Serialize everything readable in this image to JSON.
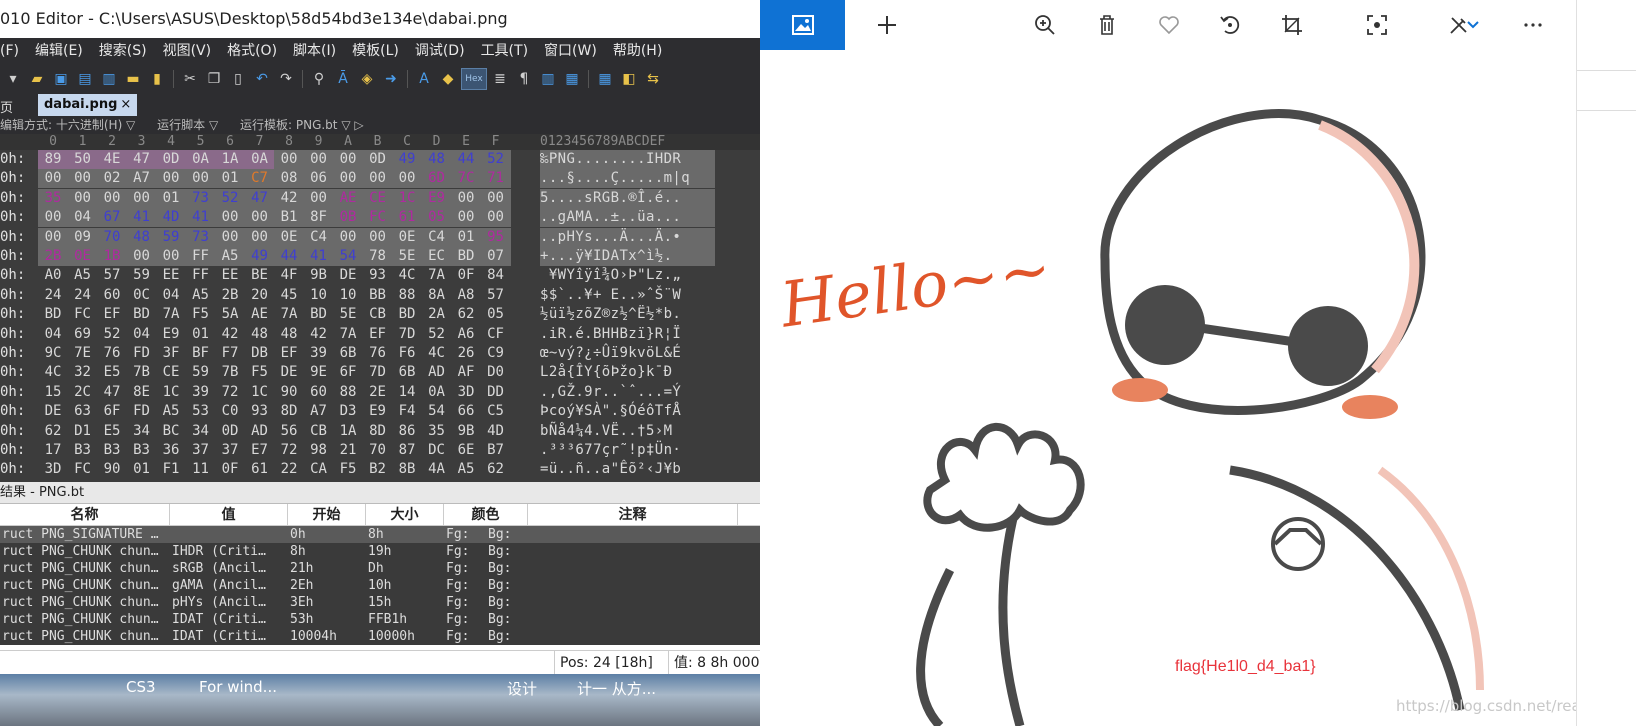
{
  "editor": {
    "title": "010 Editor - C:\\Users\\ASUS\\Desktop\\58d54bd3e134e\\dabai.png",
    "menu": [
      "(F)",
      "编辑(E)",
      "搜索(S)",
      "视图(V)",
      "格式(O)",
      "脚本(I)",
      "模板(L)",
      "调试(D)",
      "工具(T)",
      "窗口(W)",
      "帮助(H)"
    ],
    "tab_home": "页",
    "tab_file": "dabai.png",
    "tab_close": "×",
    "options": {
      "edit_mode": "编辑方式: 十六进制(H) ▽",
      "run_script": "运行脚本 ▽",
      "run_template": "运行模板: PNG.bt ▽ ▷"
    },
    "hex_header_cols": [
      "0",
      "1",
      "2",
      "3",
      "4",
      "5",
      "6",
      "7",
      "8",
      "9",
      "A",
      "B",
      "C",
      "D",
      "E",
      "F"
    ],
    "ascii_header": "0123456789ABCDEF",
    "rows": [
      {
        "off": "0h:",
        "bytes": [
          "89",
          "50",
          "4E",
          "47",
          "0D",
          "0A",
          "1A",
          "0A",
          "00",
          "00",
          "00",
          "0D",
          "49",
          "48",
          "44",
          "52"
        ],
        "ascii": "‰PNG........IHDR"
      },
      {
        "off": "0h:",
        "bytes": [
          "00",
          "00",
          "02",
          "A7",
          "00",
          "00",
          "01",
          "C7",
          "08",
          "06",
          "00",
          "00",
          "00",
          "6D",
          "7C",
          "71"
        ],
        "ascii": "...§....Ç.....m|q"
      },
      {
        "off": "0h:",
        "bytes": [
          "35",
          "00",
          "00",
          "00",
          "01",
          "73",
          "52",
          "47",
          "42",
          "00",
          "AE",
          "CE",
          "1C",
          "E9",
          "00",
          "00"
        ],
        "ascii": "5....sRGB.®Î.é.."
      },
      {
        "off": "0h:",
        "bytes": [
          "00",
          "04",
          "67",
          "41",
          "4D",
          "41",
          "00",
          "00",
          "B1",
          "8F",
          "0B",
          "FC",
          "61",
          "05",
          "00",
          "00"
        ],
        "ascii": "..gAMA..±..üa..."
      },
      {
        "off": "0h:",
        "bytes": [
          "00",
          "09",
          "70",
          "48",
          "59",
          "73",
          "00",
          "00",
          "0E",
          "C4",
          "00",
          "00",
          "0E",
          "C4",
          "01",
          "95"
        ],
        "ascii": "..pHYs...Ä...Ä.•"
      },
      {
        "off": "0h:",
        "bytes": [
          "2B",
          "0E",
          "1B",
          "00",
          "00",
          "FF",
          "A5",
          "49",
          "44",
          "41",
          "54",
          "78",
          "5E",
          "EC",
          "BD",
          "07"
        ],
        "ascii": "+...ÿ¥IDATx^ì½."
      },
      {
        "off": "0h:",
        "bytes": [
          "A0",
          "A5",
          "57",
          "59",
          "EE",
          "FF",
          "EE",
          "BE",
          "4F",
          "9B",
          "DE",
          "93",
          "4C",
          "7A",
          "0F",
          "84"
        ],
        "ascii": " ¥WYîÿî¾O›Þ\"Lz.„"
      },
      {
        "off": "0h:",
        "bytes": [
          "24",
          "24",
          "60",
          "0C",
          "04",
          "A5",
          "2B",
          "20",
          "45",
          "10",
          "10",
          "BB",
          "88",
          "8A",
          "A8",
          "57"
        ],
        "ascii": "$$`..¥+ E..»ˆŠ¨W"
      },
      {
        "off": "0h:",
        "bytes": [
          "BD",
          "FC",
          "EF",
          "BD",
          "7A",
          "F5",
          "5A",
          "AE",
          "7A",
          "BD",
          "5E",
          "CB",
          "BD",
          "2A",
          "62",
          "05"
        ],
        "ascii": "½üï½zõZ®z½^Ë½*b."
      },
      {
        "off": "0h:",
        "bytes": [
          "04",
          "69",
          "52",
          "04",
          "E9",
          "01",
          "42",
          "48",
          "48",
          "42",
          "7A",
          "EF",
          "7D",
          "52",
          "A6",
          "CF"
        ],
        "ascii": ".iR.é.BHHBzï}R¦Ï"
      },
      {
        "off": "0h:",
        "bytes": [
          "9C",
          "7E",
          "76",
          "FD",
          "3F",
          "BF",
          "F7",
          "DB",
          "EF",
          "39",
          "6B",
          "76",
          "F6",
          "4C",
          "26",
          "C9"
        ],
        "ascii": "œ~vý?¿÷Ûï9kvöL&É"
      },
      {
        "off": "0h:",
        "bytes": [
          "4C",
          "32",
          "E5",
          "7B",
          "CE",
          "59",
          "7B",
          "F5",
          "DE",
          "9E",
          "6F",
          "7D",
          "6B",
          "AD",
          "AF",
          "D0"
        ],
        "ascii": "L2å{ÎY{õÞžo}k­¯Ð"
      },
      {
        "off": "0h:",
        "bytes": [
          "15",
          "2C",
          "47",
          "8E",
          "1C",
          "39",
          "72",
          "1C",
          "90",
          "60",
          "88",
          "2E",
          "14",
          "0A",
          "3D",
          "DD"
        ],
        "ascii": ".,GŽ.9r..`ˆ...=Ý"
      },
      {
        "off": "0h:",
        "bytes": [
          "DE",
          "63",
          "6F",
          "FD",
          "A5",
          "53",
          "C0",
          "93",
          "8D",
          "A7",
          "D3",
          "E9",
          "F4",
          "54",
          "66",
          "C5"
        ],
        "ascii": "Þcoý¥SÀ\".§ÓéôTfÅ"
      },
      {
        "off": "0h:",
        "bytes": [
          "62",
          "D1",
          "E5",
          "34",
          "BC",
          "34",
          "0D",
          "AD",
          "56",
          "CB",
          "1A",
          "8D",
          "86",
          "35",
          "9B",
          "4D"
        ],
        "ascii": "bÑå4¼4.­VË..†5›M"
      },
      {
        "off": "0h:",
        "bytes": [
          "17",
          "B3",
          "B3",
          "B3",
          "36",
          "37",
          "37",
          "E7",
          "72",
          "98",
          "21",
          "70",
          "87",
          "DC",
          "6E",
          "B7"
        ],
        "ascii": ".³³³677çr˜!p‡Ün·"
      },
      {
        "off": "0h:",
        "bytes": [
          "3D",
          "FC",
          "90",
          "01",
          "F1",
          "11",
          "0F",
          "61",
          "22",
          "CA",
          "F5",
          "B2",
          "8B",
          "4A",
          "A5",
          "62"
        ],
        "ascii": "=ü..ñ..a\"Êõ²‹J¥b"
      }
    ],
    "results": {
      "title": "结果 - PNG.bt",
      "headers": [
        "名称",
        "值",
        "开始",
        "大小",
        "颜色",
        "注释"
      ],
      "rows": [
        {
          "name": "ruct PNG_SIGNATURE …",
          "value": "",
          "start": "0h",
          "size": "8h",
          "fg": "Fg:",
          "bg": "Bg:"
        },
        {
          "name": "ruct PNG_CHUNK chun…",
          "value": "IHDR  (Criti…",
          "start": "8h",
          "size": "19h",
          "fg": "Fg:",
          "bg": "Bg:"
        },
        {
          "name": "ruct PNG_CHUNK chun…",
          "value": "sRGB  (Ancil…",
          "start": "21h",
          "size": "Dh",
          "fg": "Fg:",
          "bg": "Bg:"
        },
        {
          "name": "ruct PNG_CHUNK chun…",
          "value": "gAMA  (Ancil…",
          "start": "2Eh",
          "size": "10h",
          "fg": "Fg:",
          "bg": "Bg:"
        },
        {
          "name": "ruct PNG_CHUNK chun…",
          "value": "pHYs  (Ancil…",
          "start": "3Eh",
          "size": "15h",
          "fg": "Fg:",
          "bg": "Bg:"
        },
        {
          "name": "ruct PNG_CHUNK chun…",
          "value": "IDAT  (Criti…",
          "start": "53h",
          "size": "FFB1h",
          "fg": "Fg:",
          "bg": "Bg:"
        },
        {
          "name": "ruct PNG_CHUNK chun…",
          "value": "IDAT  (Criti…",
          "start": "10004h",
          "size": "10000h",
          "fg": "Fg:",
          "bg": "Bg:"
        }
      ]
    },
    "status": {
      "pos": "Pos: 24 [18h]",
      "value": "值: 8 8h 000"
    },
    "taskbar": [
      "CS3",
      "For wind...",
      "设计",
      "计一 从方..."
    ]
  },
  "viewer": {
    "image_text": {
      "greeting": "Hello~~",
      "flag": "flag{He1l0_d4_ba1}",
      "watermark": "https://blog.csdn.net/realstarstarli"
    },
    "colors": {
      "accent": "#0f72d4",
      "greeting": "#e0552a",
      "flag": "#e8333b",
      "blush": "#e8835e"
    },
    "icons": [
      "image-icon",
      "plus-icon",
      "zoom-in-icon",
      "delete-icon",
      "heart-icon",
      "rotate-icon",
      "crop-icon",
      "focus-icon",
      "edit-icon",
      "more-icon"
    ]
  }
}
